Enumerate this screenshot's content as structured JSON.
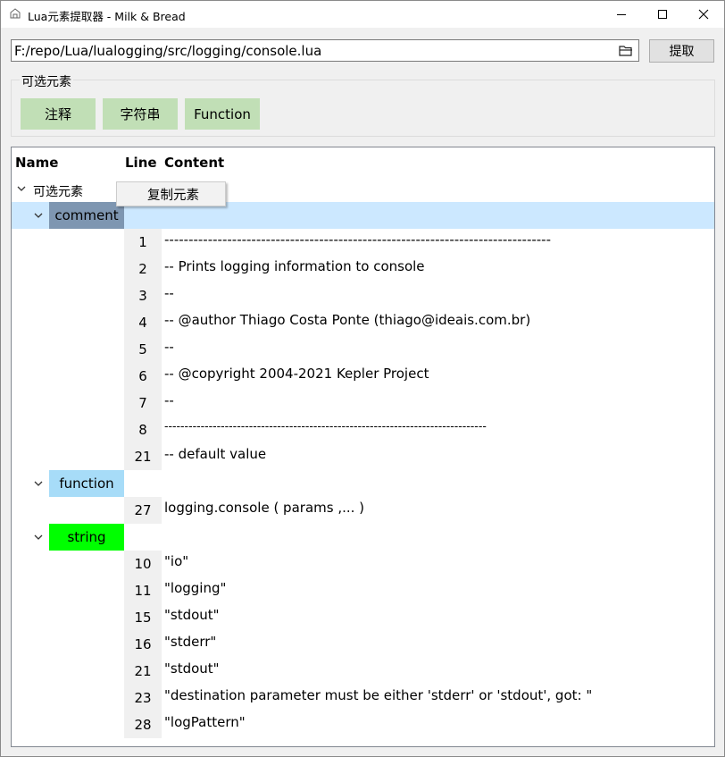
{
  "window": {
    "title": "Lua元素提取器 - Milk & Bread"
  },
  "toolbar": {
    "path": "F:/repo/Lua/lualogging/src/logging/console.lua",
    "extract_label": "提取"
  },
  "filters": {
    "group_label": "可选元素",
    "chips": [
      "注释",
      "字符串",
      "Function"
    ]
  },
  "tree": {
    "headers": {
      "name": "Name",
      "line": "Line",
      "content": "Content"
    },
    "root_label": "可选元素",
    "categories": [
      {
        "name": "comment",
        "color": "#7e96b1",
        "items": [
          {
            "line": "1",
            "content": "--------------------------------------------------------------------------------"
          },
          {
            "line": "2",
            "content": "-- Prints logging information to console"
          },
          {
            "line": "3",
            "content": "--"
          },
          {
            "line": "4",
            "content": "-- @author Thiago Costa Ponte (thiago@ideais.com.br)"
          },
          {
            "line": "5",
            "content": "--"
          },
          {
            "line": "6",
            "content": "-- @copyright 2004-2021 Kepler Project"
          },
          {
            "line": "7",
            "content": "--"
          },
          {
            "line": "8",
            "content": "--------------------------------------------------------------------------------"
          },
          {
            "line": "21",
            "content": "-- default value"
          }
        ]
      },
      {
        "name": "function",
        "color": "#a7dcf8",
        "items": [
          {
            "line": "27",
            "content": "logging.console ( params ,... )"
          }
        ]
      },
      {
        "name": "string",
        "color": "#00ff00",
        "items": [
          {
            "line": "10",
            "content": "\"io\""
          },
          {
            "line": "11",
            "content": "\"logging\""
          },
          {
            "line": "15",
            "content": "\"stdout\""
          },
          {
            "line": "16",
            "content": "\"stderr\""
          },
          {
            "line": "21",
            "content": "\"stdout\""
          },
          {
            "line": "23",
            "content": "\"destination parameter must be either 'stderr' or 'stdout', got: \""
          },
          {
            "line": "28",
            "content": "\"logPattern\""
          }
        ]
      }
    ]
  },
  "context_menu": {
    "copy_label": "复制元素"
  }
}
